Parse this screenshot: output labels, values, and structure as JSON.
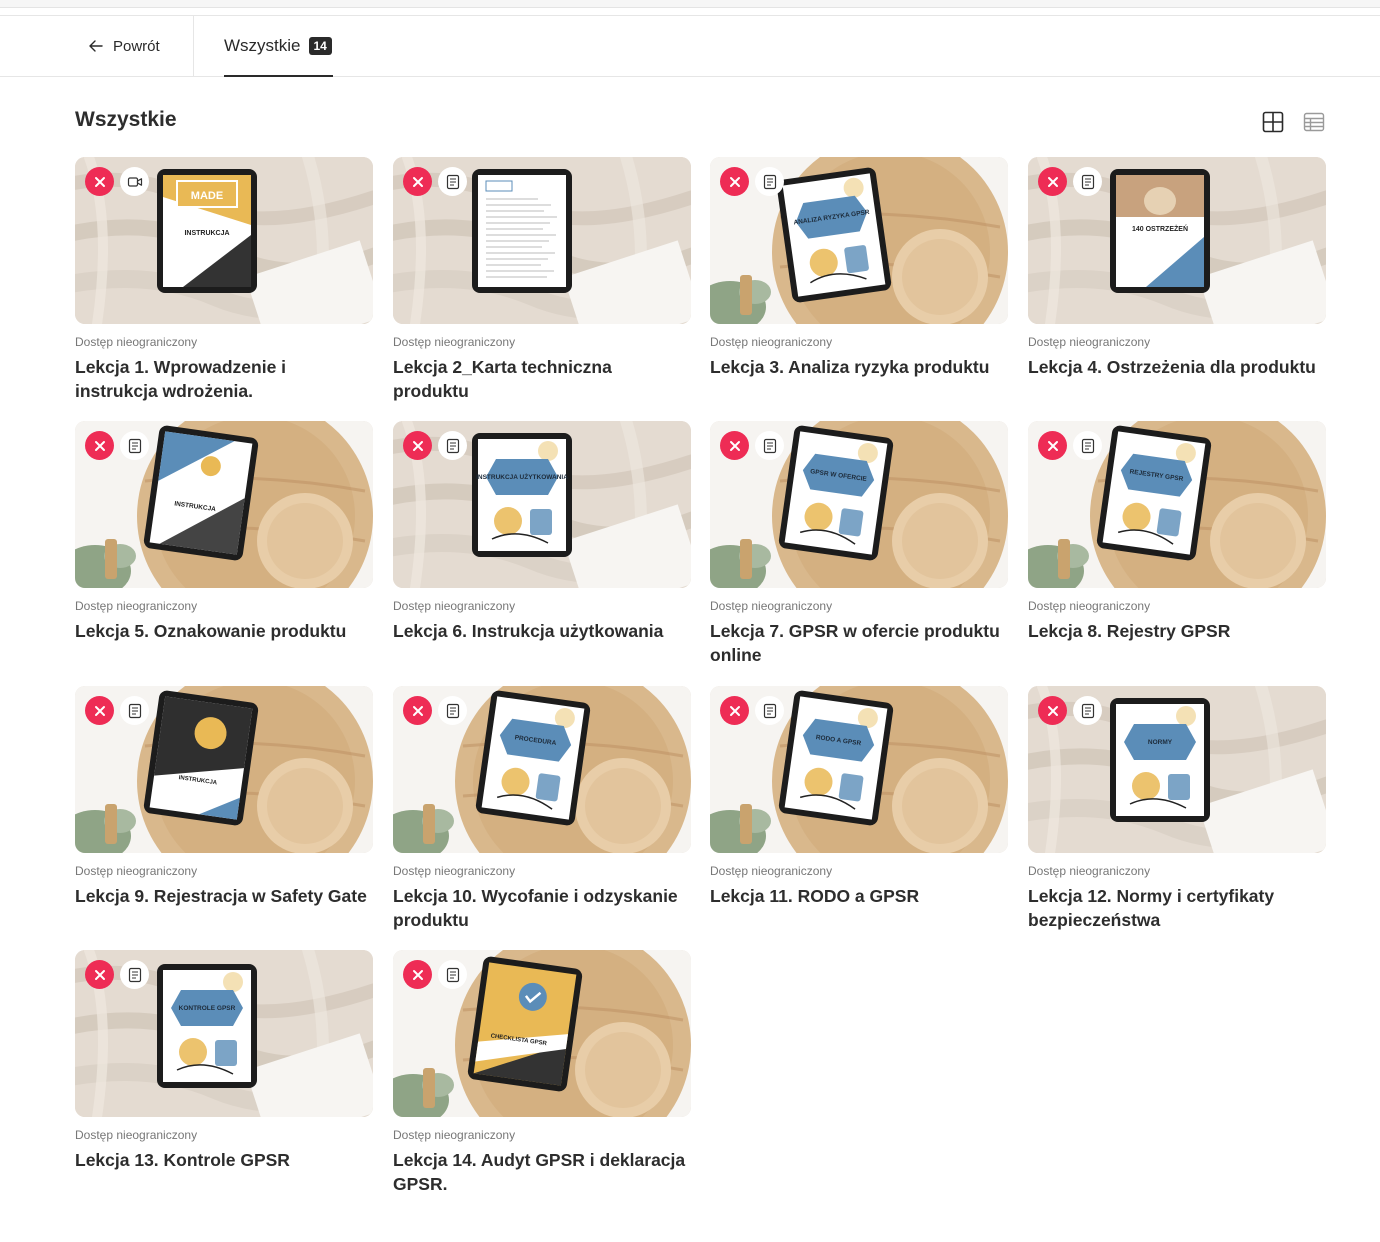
{
  "nav": {
    "back_label": "Powrót",
    "tab_label": "Wszystkie",
    "tab_count": "14"
  },
  "section": {
    "title": "Wszystkie"
  },
  "colors": {
    "accent_red": "#ee2c55",
    "ebook_yellow": "#e9b955",
    "ebook_blue": "#5b8db8",
    "dark": "#2a2a2a"
  },
  "lessons": [
    {
      "title": "Lekcja 1. Wprowadzenie i instrukcja wdrożenia.",
      "access": "Dostęp nieograniczony",
      "type_icon": "video-icon",
      "bg": "fabric",
      "cover": "handmade",
      "cover_text": "INSTRUKCJA"
    },
    {
      "title": "Lekcja 2_Karta techniczna produktu",
      "access": "Dostęp nieograniczony",
      "type_icon": "document-icon",
      "bg": "fabric",
      "cover": "doc",
      "cover_text": ""
    },
    {
      "title": "Lekcja 3. Analiza ryzyka produktu",
      "access": "Dostęp nieograniczony",
      "type_icon": "document-icon",
      "bg": "wood",
      "cover": "blue",
      "cover_text": "ANALIZA RYZYKA GPSR"
    },
    {
      "title": "Lekcja 4. Ostrzeżenia dla produktu",
      "access": "Dostęp nieograniczony",
      "type_icon": "document-icon",
      "bg": "fabric",
      "cover": "photo",
      "cover_text": "140 OSTRZEŻEŃ"
    },
    {
      "title": "Lekcja 5. Oznakowanie produktu",
      "access": "Dostęp nieograniczony",
      "type_icon": "document-icon",
      "bg": "wood",
      "cover": "bluedark",
      "cover_text": "INSTRUKCJA"
    },
    {
      "title": "Lekcja 6. Instrukcja użytkowania",
      "access": "Dostęp nieograniczony",
      "type_icon": "document-icon",
      "bg": "fabric",
      "cover": "blue",
      "cover_text": "INSTRUKCJA UŻYTKOWANIA"
    },
    {
      "title": "Lekcja 7. GPSR w ofercie produktu online",
      "access": "Dostęp nieograniczony",
      "type_icon": "document-icon",
      "bg": "wood",
      "cover": "blue",
      "cover_text": "GPSR W OFERCIE"
    },
    {
      "title": "Lekcja 8. Rejestry GPSR",
      "access": "Dostęp nieograniczony",
      "type_icon": "document-icon",
      "bg": "wood",
      "cover": "blue",
      "cover_text": "REJESTRY GPSR"
    },
    {
      "title": "Lekcja 9. Rejestracja w Safety Gate",
      "access": "Dostęp nieograniczony",
      "type_icon": "document-icon",
      "bg": "wood",
      "cover": "dark",
      "cover_text": "INSTRUKCJA"
    },
    {
      "title": "Lekcja 10. Wycofanie i odzyskanie produktu",
      "access": "Dostęp nieograniczony",
      "type_icon": "document-icon",
      "bg": "wood",
      "cover": "blue",
      "cover_text": "PROCEDURA"
    },
    {
      "title": "Lekcja 11. RODO a GPSR",
      "access": "Dostęp nieograniczony",
      "type_icon": "document-icon",
      "bg": "wood",
      "cover": "blue",
      "cover_text": "RODO A GPSR"
    },
    {
      "title": "Lekcja 12. Normy i certyfikaty bezpieczeństwa",
      "access": "Dostęp nieograniczony",
      "type_icon": "document-icon",
      "bg": "fabric",
      "cover": "blue",
      "cover_text": "NORMY"
    },
    {
      "title": "Lekcja 13. Kontrole GPSR",
      "access": "Dostęp nieograniczony",
      "type_icon": "document-icon",
      "bg": "fabric",
      "cover": "blue",
      "cover_text": "KONTROLE GPSR"
    },
    {
      "title": "Lekcja 14. Audyt GPSR i deklaracja GPSR.",
      "access": "Dostęp nieograniczony",
      "type_icon": "document-icon",
      "bg": "wood",
      "cover": "yellow",
      "cover_text": "CHECKLISTA GPSR"
    }
  ]
}
